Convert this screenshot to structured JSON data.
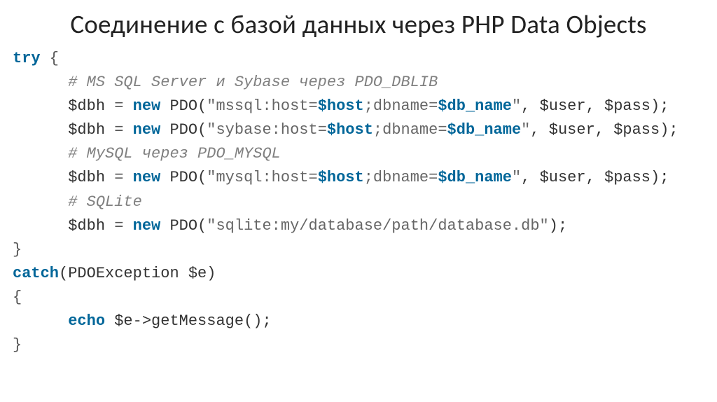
{
  "title": "Соединение с базой данных через PHP Data Objects",
  "code": {
    "l1": {
      "try": "try",
      "brace": " {"
    },
    "l2": {
      "comment": "# MS SQL Server и Sybase через PDO_DBLIB"
    },
    "l3": {
      "var": "$dbh",
      "eq": " = ",
      "new": "new",
      "pdo": " PDO(",
      "q1": "\"mssql:host=",
      "iv1": "$host",
      "mid": ";dbname=",
      "iv2": "$db_name",
      "q2": "\"",
      "rest": ", $user, $pass);"
    },
    "l4": {
      "var": "$dbh",
      "eq": " = ",
      "new": "new",
      "pdo": " PDO(",
      "q1": "\"sybase:host=",
      "iv1": "$host",
      "mid": ";dbname=",
      "iv2": "$db_name",
      "q2": "\"",
      "rest": ", $user, $pass);"
    },
    "l5": {
      "comment": "# MySQL через PDO_MYSQL"
    },
    "l6": {
      "var": "$dbh",
      "eq": " = ",
      "new": "new",
      "pdo": " PDO(",
      "q1": "\"mysql:host=",
      "iv1": "$host",
      "mid": ";dbname=",
      "iv2": "$db_name",
      "q2": "\"",
      "rest": ", $user, $pass);"
    },
    "l7": {
      "comment": "# SQLite"
    },
    "l8": {
      "var": "$dbh",
      "eq": " = ",
      "new": "new",
      "pdo": " PDO(",
      "str": "\"sqlite:my/database/path/database.db\"",
      "close": ");"
    },
    "l9": {
      "brace": "}"
    },
    "l10": {
      "catch": "catch",
      "rest": "(PDOException $e)"
    },
    "l11": {
      "brace": "{"
    },
    "l12": {
      "echo": "echo",
      "rest": " $e->getMessage();"
    },
    "l13": {
      "brace": "}"
    }
  }
}
